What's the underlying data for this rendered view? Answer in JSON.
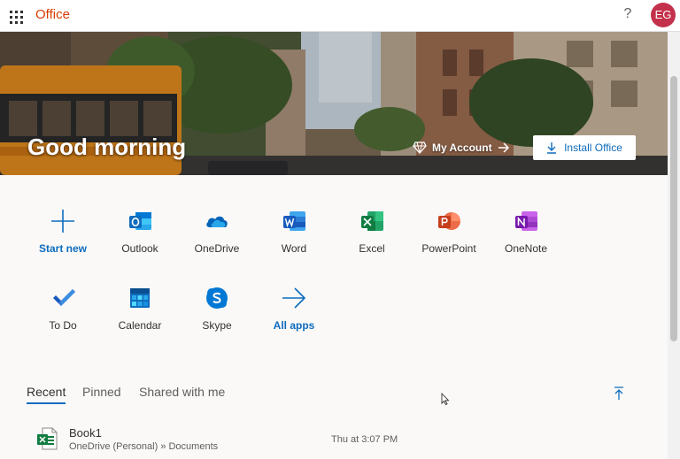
{
  "header": {
    "app_name": "Office",
    "help_label": "?",
    "avatar_initials": "EG",
    "brand_color": "#d83b01",
    "avatar_color": "#c4314b"
  },
  "hero": {
    "greeting": "Good morning",
    "my_account_label": "My Account",
    "install_label": "Install Office"
  },
  "apps": [
    {
      "label": "Start new",
      "icon": "plus-icon"
    },
    {
      "label": "Outlook",
      "icon": "outlook-icon"
    },
    {
      "label": "OneDrive",
      "icon": "onedrive-icon"
    },
    {
      "label": "Word",
      "icon": "word-icon"
    },
    {
      "label": "Excel",
      "icon": "excel-icon"
    },
    {
      "label": "PowerPoint",
      "icon": "powerpoint-icon"
    },
    {
      "label": "OneNote",
      "icon": "onenote-icon"
    },
    {
      "label": "To Do",
      "icon": "todo-icon"
    },
    {
      "label": "Calendar",
      "icon": "calendar-icon"
    },
    {
      "label": "Skype",
      "icon": "skype-icon"
    },
    {
      "label": "All apps",
      "icon": "arrow-right-icon"
    }
  ],
  "tabs": [
    {
      "label": "Recent",
      "active": true
    },
    {
      "label": "Pinned",
      "active": false
    },
    {
      "label": "Shared with me",
      "active": false
    }
  ],
  "files": [
    {
      "name": "Book1",
      "location": "OneDrive (Personal) » Documents",
      "modified": "Thu at 3:07 PM",
      "icon": "excel-file-icon"
    }
  ],
  "colors": {
    "accent": "#0f6cbd",
    "word": "#185abd",
    "excel": "#107c41",
    "powerpoint": "#c43e1c",
    "onenote": "#7719aa",
    "outlook": "#0f6cbd",
    "onedrive": "#0364b8"
  }
}
